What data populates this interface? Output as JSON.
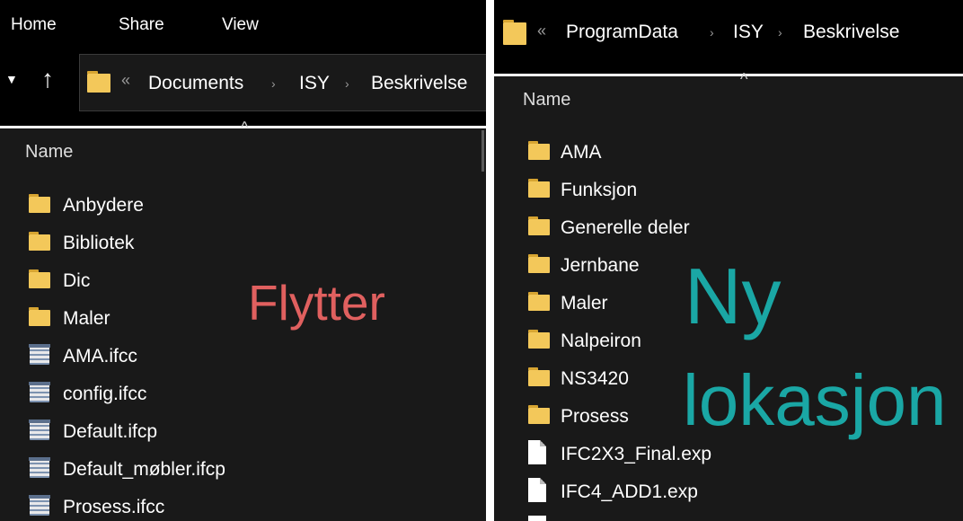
{
  "left": {
    "ribbon": {
      "tabs": [
        "Home",
        "Share",
        "View"
      ]
    },
    "address": {
      "overflow": "«",
      "crumbs": [
        "Documents",
        "ISY",
        "Beskrivelse"
      ]
    },
    "column_header": "Name",
    "items": [
      {
        "name": "Anbydere",
        "icon": "folder-icon"
      },
      {
        "name": "Bibliotek",
        "icon": "folder-icon"
      },
      {
        "name": "Dic",
        "icon": "folder-icon"
      },
      {
        "name": "Maler",
        "icon": "folder-icon"
      },
      {
        "name": "AMA.ifcc",
        "icon": "ifcc-file-icon"
      },
      {
        "name": "config.ifcc",
        "icon": "ifcc-file-icon"
      },
      {
        "name": "Default.ifcp",
        "icon": "ifcc-file-icon"
      },
      {
        "name": "Default_møbler.ifcp",
        "icon": "ifcc-file-icon"
      },
      {
        "name": "Prosess.ifcc",
        "icon": "ifcc-file-icon"
      }
    ],
    "overlay_text": "Flytter",
    "overlay_color": "#e0605f"
  },
  "right": {
    "address": {
      "overflow": "«",
      "crumbs": [
        "ProgramData",
        "ISY",
        "Beskrivelse"
      ]
    },
    "column_header": "Name",
    "items": [
      {
        "name": "AMA",
        "icon": "folder-icon"
      },
      {
        "name": "Funksjon",
        "icon": "folder-icon"
      },
      {
        "name": "Generelle deler",
        "icon": "folder-icon"
      },
      {
        "name": "Jernbane",
        "icon": "folder-icon"
      },
      {
        "name": "Maler",
        "icon": "folder-icon"
      },
      {
        "name": "Nalpeiron",
        "icon": "folder-icon"
      },
      {
        "name": "NS3420",
        "icon": "folder-icon"
      },
      {
        "name": "Prosess",
        "icon": "folder-icon"
      },
      {
        "name": "IFC2X3_Final.exp",
        "icon": "document-icon"
      },
      {
        "name": "IFC4_ADD1.exp",
        "icon": "document-icon"
      }
    ],
    "overlay_line1": "Ny",
    "overlay_line2": "lokasjon",
    "overlay_color": "#1aa7a5"
  },
  "colors": {
    "window_bg": "#191919",
    "ribbon_bg": "#000000",
    "folder_yellow": "#f3c85a",
    "divider": "#ffffff"
  }
}
